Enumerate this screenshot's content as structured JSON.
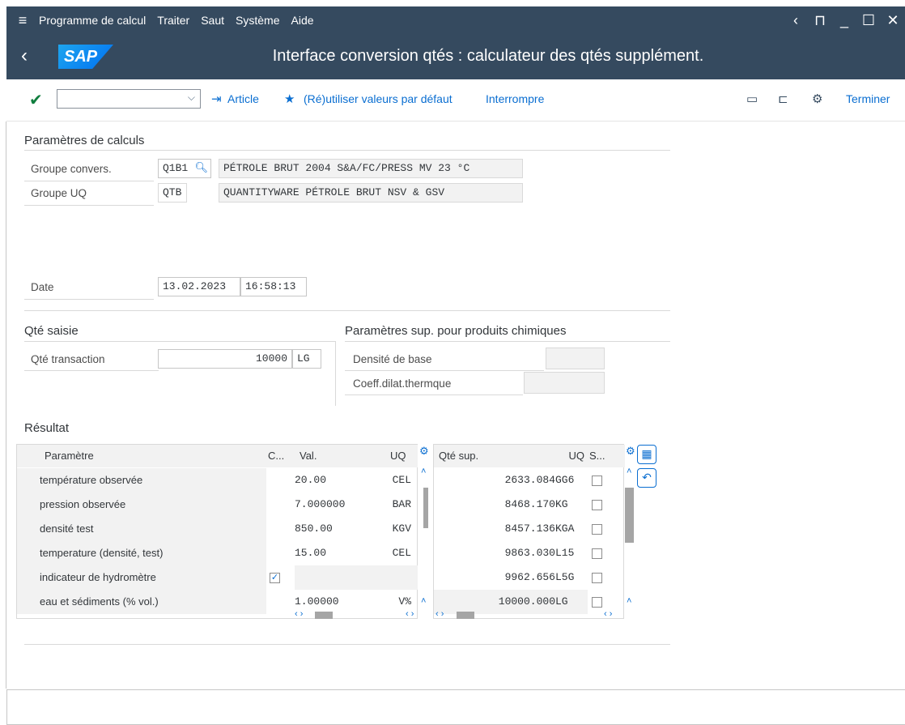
{
  "menu": {
    "items": [
      "Programme de calcul",
      "Traiter",
      "Saut",
      "Système",
      "Aide"
    ],
    "right_icons": [
      "chevron-left-icon",
      "unlock-icon",
      "minimize-icon",
      "maximize-icon",
      "close-icon"
    ]
  },
  "titlebar": {
    "logo": "SAP",
    "title": "Interface conversion qtés : calculateur des qtés supplément."
  },
  "toolbar": {
    "command_value": "",
    "article_label": "Article",
    "defaults_label": "(Ré)utiliser valeurs par défaut",
    "interrupt_label": "Interrompre",
    "terminate_label": "Terminer"
  },
  "params": {
    "title": "Paramètres de calculs",
    "groupe_convers_label": "Groupe convers.",
    "groupe_convers_value": "Q1B1",
    "groupe_convers_desc": "PÉTROLE BRUT 2004 S&A/FC/PRESS MV 23 °C",
    "groupe_uq_label": "Groupe UQ",
    "groupe_uq_value": "QTB",
    "groupe_uq_desc": "QUANTITYWARE PÉTROLE BRUT NSV & GSV",
    "date_label": "Date",
    "date_value": "13.02.2023",
    "time_value": "16:58:13"
  },
  "qty": {
    "title": "Qté saisie",
    "label": "Qté transaction",
    "value": "10000",
    "unit": "LG"
  },
  "chem": {
    "title": "Paramètres sup. pour produits chimiques",
    "density_label": "Densité de base",
    "density_value": "",
    "coeff_label": "Coeff.dilat.thermque",
    "coeff_value": ""
  },
  "result": {
    "title": "Résultat",
    "left_headers": {
      "param": "Paramètre",
      "c": "C...",
      "val": "Val.",
      "uq": "UQ"
    },
    "right_headers": {
      "qty": "Qté sup.",
      "uq": "UQ",
      "s": "S..."
    },
    "rows": [
      {
        "param": "température observée",
        "checked": false,
        "val": "20.00",
        "uq": "CEL"
      },
      {
        "param": "pression observée",
        "checked": false,
        "val": "7.000000",
        "uq": "BAR"
      },
      {
        "param": "densité test",
        "checked": false,
        "val": "850.00",
        "uq": "KGV"
      },
      {
        "param": "temperature (densité, test)",
        "checked": false,
        "val": "15.00",
        "uq": "CEL"
      },
      {
        "param": "indicateur de hydromètre",
        "checked": true,
        "val": "",
        "uq": ""
      },
      {
        "param": "eau et sédiments (% vol.)",
        "checked": false,
        "val": "1.00000",
        "uq": "V%"
      }
    ],
    "qty_rows": [
      {
        "qty": "2633.084",
        "uq": "GG6"
      },
      {
        "qty": "8468.170",
        "uq": "KG"
      },
      {
        "qty": "8457.136",
        "uq": "KGA"
      },
      {
        "qty": "9863.030",
        "uq": "L15"
      },
      {
        "qty": "9962.656",
        "uq": "L5G"
      },
      {
        "qty": "10000.000",
        "uq": "LG"
      }
    ]
  }
}
